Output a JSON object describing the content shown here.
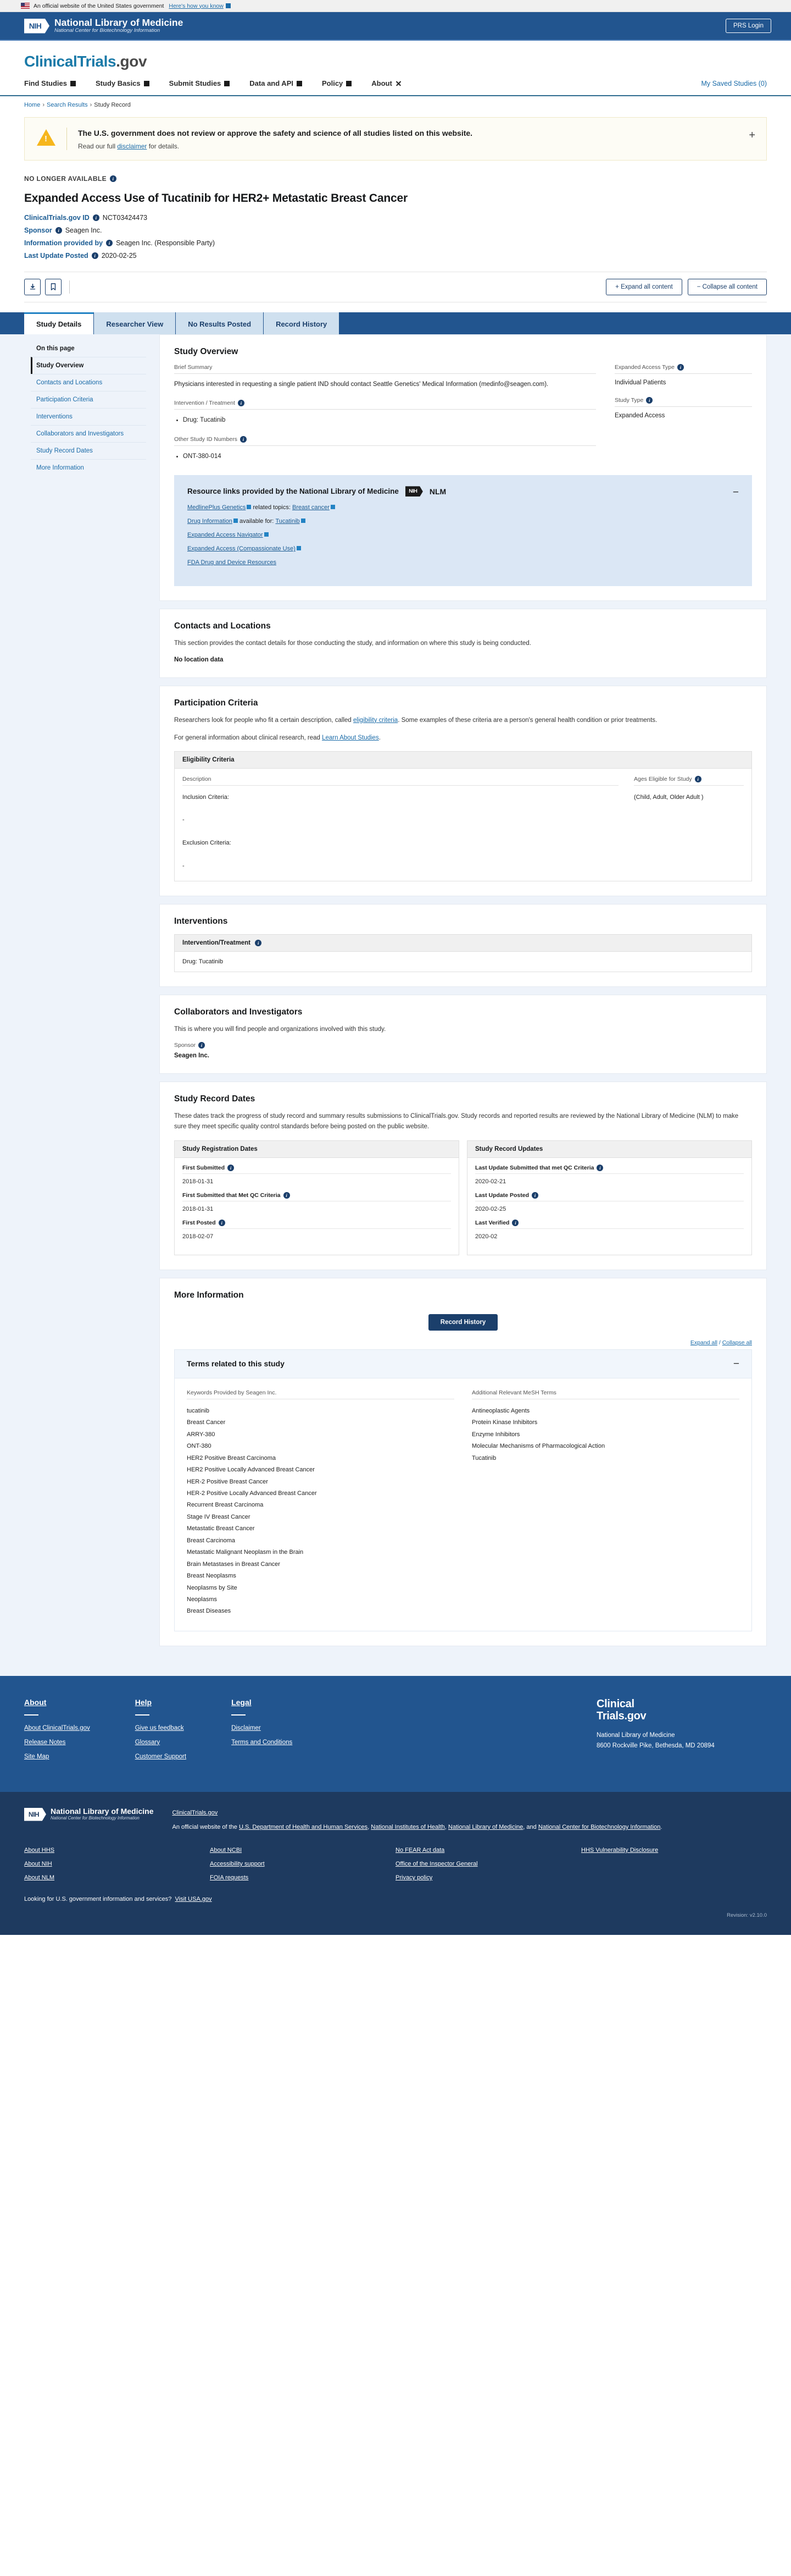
{
  "gov_banner": {
    "text": "An official website of the United States government",
    "howto": "Here's how you know"
  },
  "nlm_header": {
    "mark": "NIH",
    "title": "National Library of Medicine",
    "subtitle": "National Center for Biotechnology Information",
    "prs_login": "PRS Login"
  },
  "brand": {
    "part1": "ClinicalTrials",
    "part2": ".gov"
  },
  "menu": {
    "items": [
      {
        "label": "Find Studies"
      },
      {
        "label": "Study Basics"
      },
      {
        "label": "Submit Studies"
      },
      {
        "label": "Data and API"
      },
      {
        "label": "Policy"
      },
      {
        "label": "About"
      }
    ],
    "saved_studies": "My Saved Studies (0)"
  },
  "breadcrumb": {
    "home": "Home",
    "search": "Search Results",
    "current": "Study Record"
  },
  "alert": {
    "title": "The U.S. government does not review or approve the safety and science of all studies listed on this website.",
    "sub_pre": "Read our full ",
    "sub_link": "disclaimer",
    "sub_post": " for details.",
    "expand": "+"
  },
  "study": {
    "status": "NO LONGER AVAILABLE",
    "title": "Expanded Access Use of Tucatinib for HER2+ Metastatic Breast Cancer",
    "meta": [
      {
        "label": "ClinicalTrials.gov ID",
        "value": "NCT03424473"
      },
      {
        "label": "Sponsor",
        "value": "Seagen Inc."
      },
      {
        "label": "Information provided by",
        "value": "Seagen Inc. (Responsible Party)"
      },
      {
        "label": "Last Update Posted",
        "value": "2020-02-25"
      }
    ]
  },
  "actions": {
    "download_icon": "download-icon",
    "save_icon": "bookmark-icon",
    "expand_all": "+  Expand all content",
    "collapse_all": "−  Collapse all content"
  },
  "tabs": [
    {
      "label": "Study Details",
      "active": true
    },
    {
      "label": "Researcher View",
      "active": false
    },
    {
      "label": "No Results Posted",
      "active": false
    },
    {
      "label": "Record History",
      "active": false
    }
  ],
  "sidebar": {
    "title": "On this page",
    "items": [
      {
        "label": "Study Overview",
        "active": true
      },
      {
        "label": "Contacts and Locations",
        "active": false
      },
      {
        "label": "Participation Criteria",
        "active": false
      },
      {
        "label": "Interventions",
        "active": false
      },
      {
        "label": "Collaborators and Investigators",
        "active": false
      },
      {
        "label": "Study Record Dates",
        "active": false
      },
      {
        "label": "More Information",
        "active": false
      }
    ]
  },
  "overview": {
    "heading": "Study Overview",
    "brief_summary_label": "Brief Summary",
    "brief_summary": "Physicians interested in requesting a single patient IND should contact Seattle Genetics' Medical Information (medinfo@seagen.com).",
    "intervention_label": "Intervention / Treatment",
    "interventions": [
      "Drug: Tucatinib"
    ],
    "other_ids_label": "Other Study ID Numbers",
    "other_ids": [
      "ONT-380-014"
    ],
    "expanded_access_type_label": "Expanded Access Type",
    "expanded_access_type": "Individual Patients",
    "study_type_label": "Study Type",
    "study_type": "Expanded Access"
  },
  "nlm_resources": {
    "title": "Resource links provided by the National Library of Medicine",
    "mark": "NIH",
    "abbr": "NLM",
    "collapse": "−",
    "rows": [
      {
        "link": "MedlinePlus Genetics",
        "mid": " related topics:",
        "link2": "Breast cancer"
      },
      {
        "link": "Drug Information",
        "mid": " available for:",
        "link2": "Tucatinib"
      },
      {
        "link": "Expanded Access Navigator",
        "mid": "",
        "link2": ""
      },
      {
        "link": "Expanded Access (Compassionate Use)",
        "mid": "",
        "link2": ""
      },
      {
        "link": "FDA Drug and Device Resources",
        "mid": "",
        "link2": "",
        "no_ext": true
      }
    ]
  },
  "contacts": {
    "heading": "Contacts and Locations",
    "lede": "This section provides the contact details for those conducting the study, and information on where this study is being conducted.",
    "no_location": "No location data"
  },
  "participation": {
    "heading": "Participation Criteria",
    "lede_1": "Researchers look for people who fit a certain description, called ",
    "lede_link": "eligibility criteria",
    "lede_2": ". Some examples of these criteria are a person's general health condition or prior treatments.",
    "lede_3": "For general information about clinical research, read ",
    "lede_link2": "Learn About Studies",
    "lede_4": ".",
    "table_title": "Eligibility Criteria",
    "col_description": "Description",
    "col_ages": "Ages Eligible for Study",
    "description_value": "Inclusion Criteria:\n\n-\n\nExclusion Criteria:\n\n-",
    "ages_value": "(Child, Adult, Older Adult )"
  },
  "interventions_section": {
    "heading": "Interventions",
    "table_title": "Intervention/Treatment",
    "rows": [
      "Drug: Tucatinib"
    ]
  },
  "collaborators": {
    "heading": "Collaborators and Investigators",
    "lede": "This is where you will find people and organizations involved with this study.",
    "sponsor_label": "Sponsor",
    "sponsor_value": "Seagen Inc."
  },
  "record_dates": {
    "heading": "Study Record Dates",
    "lede": "These dates track the progress of study record and summary results submissions to ClinicalTrials.gov. Study records and reported results are reviewed by the National Library of Medicine (NLM) to make sure they meet specific quality control standards before being posted on the public website.",
    "registration": {
      "title": "Study Registration Dates",
      "fields": [
        {
          "label": "First Submitted",
          "value": "2018-01-31"
        },
        {
          "label": "First Submitted that Met QC Criteria",
          "value": "2018-01-31"
        },
        {
          "label": "First Posted",
          "value": "2018-02-07"
        }
      ]
    },
    "updates": {
      "title": "Study Record Updates",
      "fields": [
        {
          "label": "Last Update Submitted that met QC Criteria",
          "value": "2020-02-21"
        },
        {
          "label": "Last Update Posted",
          "value": "2020-02-25"
        },
        {
          "label": "Last Verified",
          "value": "2020-02"
        }
      ]
    }
  },
  "more_info": {
    "heading": "More Information",
    "record_history_button": "Record History",
    "expand_all": "Expand all",
    "slash": " / ",
    "collapse_all": "Collapse all",
    "terms_title": "Terms related to this study",
    "collapse": "−",
    "keywords_label": "Keywords Provided by Seagen Inc.",
    "keywords": [
      "tucatinib",
      "Breast Cancer",
      "ARRY-380",
      "ONT-380",
      "HER2 Positive Breast Carcinoma",
      "HER2 Positive Locally Advanced Breast Cancer",
      "HER-2 Positive Breast Cancer",
      "HER-2 Positive Locally Advanced Breast Cancer",
      "Recurrent Breast Carcinoma",
      "Stage IV Breast Cancer",
      "Metastatic Breast Cancer",
      "Breast Carcinoma",
      "Metastatic Malignant Neoplasm in the Brain",
      "Brain Metastases in Breast Cancer",
      "Breast Neoplasms",
      "Neoplasms by Site",
      "Neoplasms",
      "Breast Diseases"
    ],
    "mesh_label": "Additional Relevant MeSH Terms",
    "mesh_terms": [
      "Antineoplastic Agents",
      "Protein Kinase Inhibitors",
      "Enzyme Inhibitors",
      "Molecular Mechanisms of Pharmacological Action",
      "Tucatinib"
    ]
  },
  "footer": {
    "columns": [
      {
        "title": "About",
        "links": [
          "About ClinicalTrials.gov",
          "Release Notes",
          "Site Map"
        ]
      },
      {
        "title": "Help",
        "links": [
          "Give us feedback",
          "Glossary",
          "Customer Support"
        ]
      },
      {
        "title": "Legal",
        "links": [
          "Disclaimer",
          "Terms and Conditions"
        ]
      }
    ],
    "brand_line1": "Clinical",
    "brand_line2": "Trials.gov",
    "address": "National Library of Medicine\n8600 Rockville Pike, Bethesda, MD 20894"
  },
  "footer_nih": {
    "mark": "NIH",
    "logo_title": "National Library of Medicine",
    "logo_sub": "National Center for Biotechnology Information",
    "site": "ClinicalTrials.gov",
    "desc_pre": "An official website of the ",
    "desc_links": [
      "U.S. Department of Health and Human Services",
      "National Institutes of Health",
      "National Library of Medicine",
      "National Center for Biotechnology Information"
    ],
    "desc_and": "and ",
    "columns": [
      [
        "About HHS",
        "About NIH",
        "About NLM"
      ],
      [
        "About NCBI",
        "Accessibility support",
        "FOIA requests"
      ],
      [
        "No FEAR Act data",
        "Office of the Inspector General",
        "Privacy policy"
      ],
      [
        "HHS Vulnerability Disclosure"
      ]
    ],
    "usa_text": "Looking for U.S. government information and services?",
    "usa_link": "Visit USA.gov",
    "revision": "Revision: v2.10.0"
  }
}
